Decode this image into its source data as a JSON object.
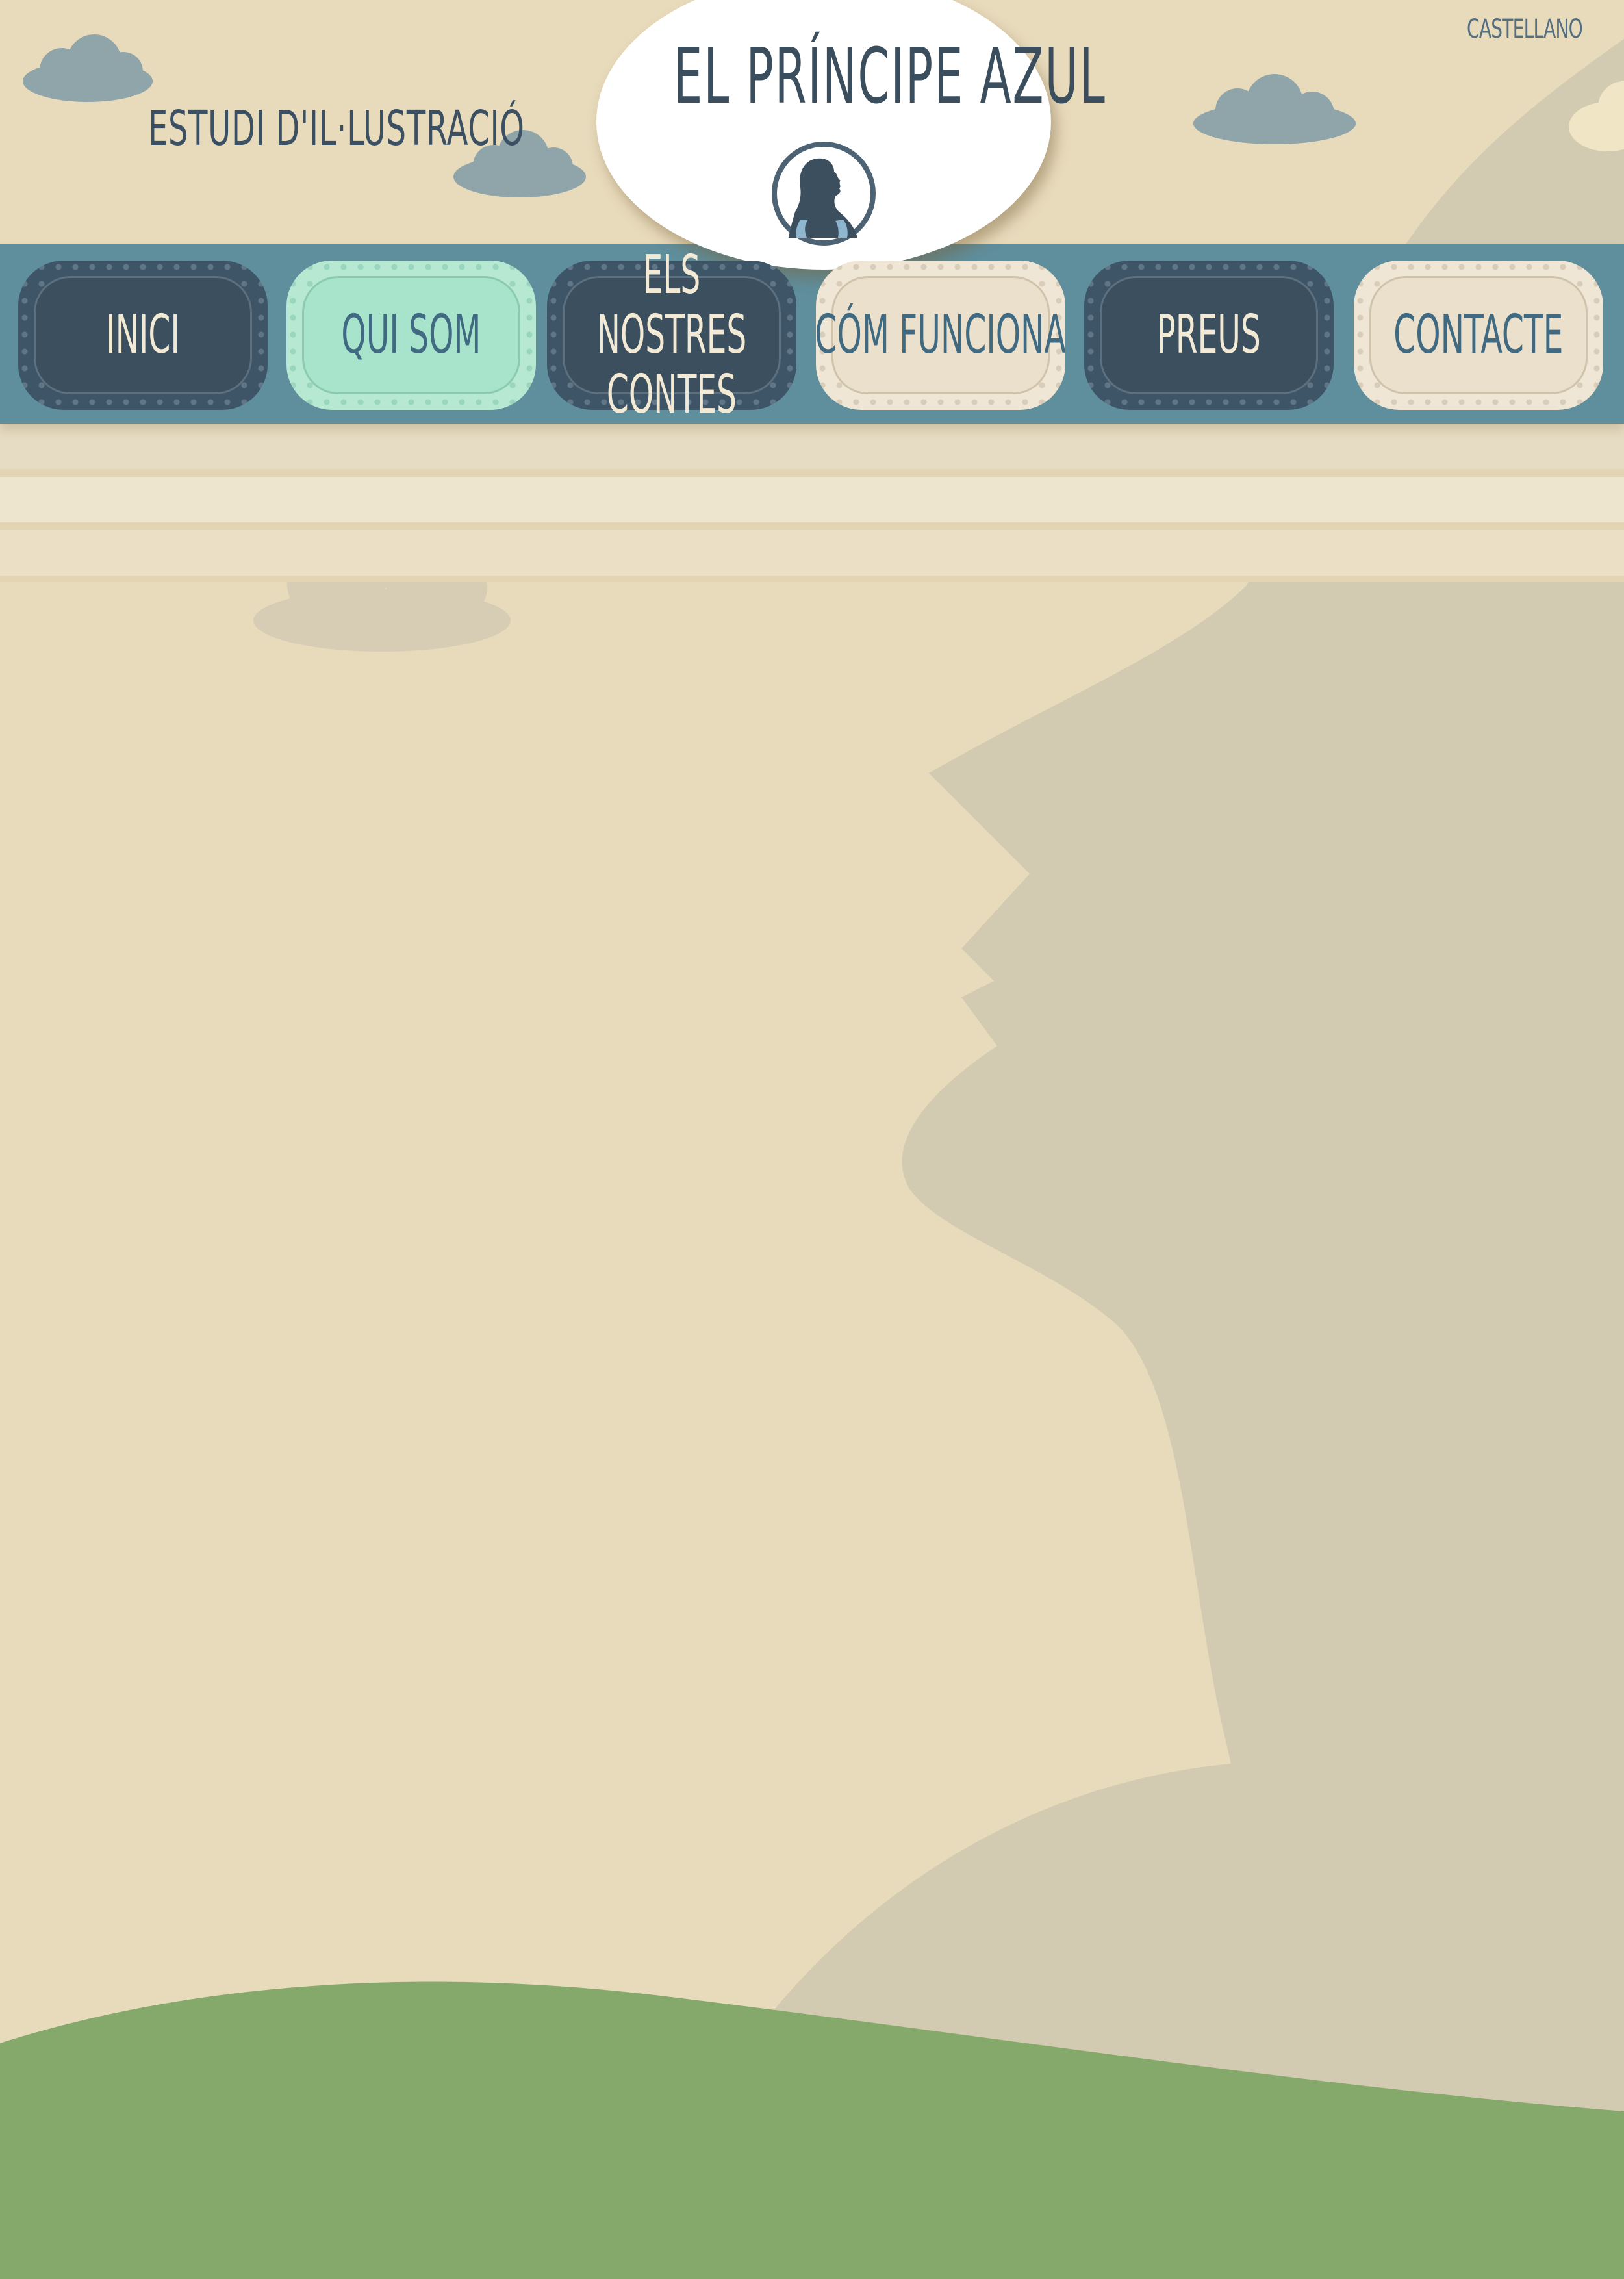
{
  "header": {
    "language_link": "castellano",
    "tagline": "Estudi d'il·lustració",
    "site_title": "El Príncipe Azul"
  },
  "nav": {
    "items": [
      {
        "label": "Inici",
        "style": "dark"
      },
      {
        "label": "Qui som",
        "style": "mint"
      },
      {
        "label": "Els nostres contes",
        "style": "dark"
      },
      {
        "label": "Cóm funciona",
        "style": "cream"
      },
      {
        "label": "Preus",
        "style": "dark"
      },
      {
        "label": "Contacte",
        "style": "cream"
      }
    ]
  },
  "colors": {
    "background": "#e8dbbc",
    "silhouette": "#d3cbb1",
    "nav_band": "#5f8e9c",
    "button_dark": "#3b4f5e",
    "button_mint": "#a8e4cb",
    "button_cream": "#ebe0cc",
    "hill": "#85a96a",
    "cloud": "#8fa5aa",
    "text_dark": "#3a4e5e"
  },
  "icons": {
    "logo": "princess-silhouette-icon",
    "clouds": "cloud-icon"
  }
}
